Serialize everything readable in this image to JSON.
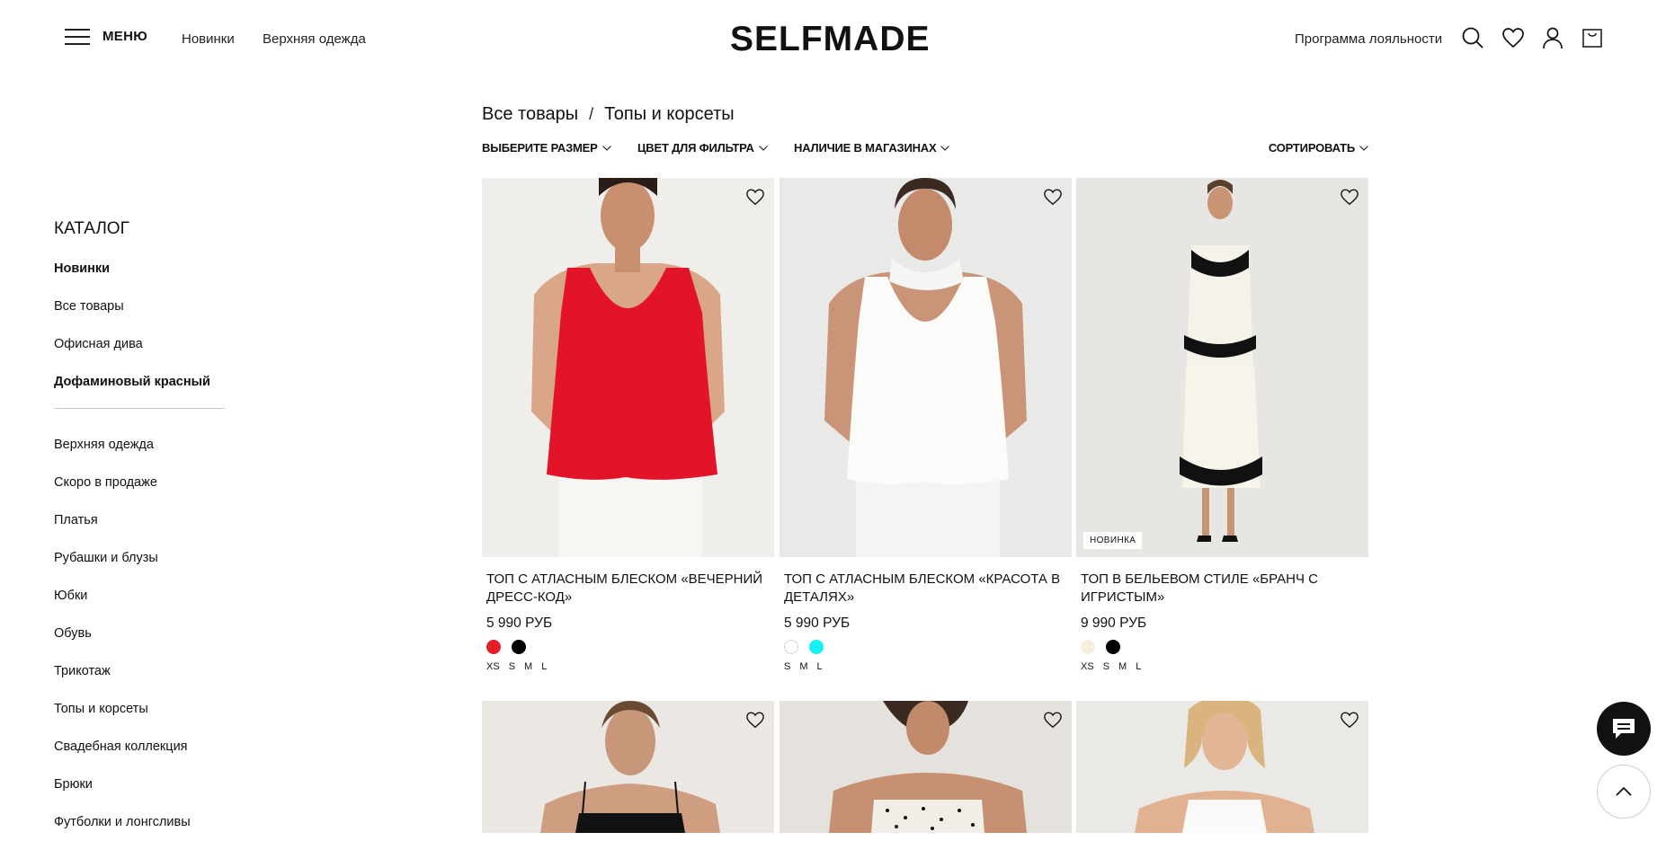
{
  "header": {
    "menu_label": "МЕНЮ",
    "nav": [
      "Новинки",
      "Верхняя одежда"
    ],
    "logo": "SELFMADE",
    "loyalty": "Программа лояльности",
    "icons": [
      "search-icon",
      "heart-icon",
      "user-icon",
      "cart-icon"
    ]
  },
  "sidebar": {
    "title": "КАТАЛОГ",
    "top_items": [
      {
        "label": "Новинки",
        "bold": true
      },
      {
        "label": "Все товары",
        "bold": false
      },
      {
        "label": "Офисная дива",
        "bold": false
      },
      {
        "label": "Дофаминовый красный",
        "bold": true
      }
    ],
    "items": [
      "Верхняя одежда",
      "Скоро в продаже",
      "Платья",
      "Рубашки и блузы",
      "Юбки",
      "Обувь",
      "Трикотаж",
      "Топы и корсеты",
      "Свадебная коллекция",
      "Брюки",
      "Футболки и лонгсливы"
    ]
  },
  "breadcrumb": {
    "root": "Все товары",
    "separator": "/",
    "current": "Топы и корсеты"
  },
  "filters": {
    "size": "ВЫБЕРИТЕ РАЗМЕР",
    "color": "ЦВЕТ ДЛЯ ФИЛЬТРА",
    "availability": "НАЛИЧИЕ В МАГАЗИНАХ",
    "sort": "СОРТИРОВАТЬ"
  },
  "products": [
    {
      "title": "ТОП С АТЛАСНЫМ БЛЕСКОМ «ВЕЧЕРНИЙ ДРЕСС-КОД»",
      "price": "5 990 РУБ",
      "badge": "",
      "swatches": [
        "#e21e26",
        "#000000"
      ],
      "sizes": [
        "XS",
        "S",
        "M",
        "L"
      ]
    },
    {
      "title": "ТОП С АТЛАСНЫМ БЛЕСКОМ «КРАСОТА В ДЕТАЛЯХ»",
      "price": "5 990 РУБ",
      "badge": "",
      "swatches": [
        "#ffffff",
        "#16f0f0"
      ],
      "sizes": [
        "S",
        "M",
        "L"
      ]
    },
    {
      "title": "ТОП В БЕЛЬЕВОМ СТИЛЕ «БРАНЧ С ИГРИСТЫМ»",
      "price": "9 990 РУБ",
      "badge": "НОВИНКА",
      "swatches": [
        "#f6eedd",
        "#000000"
      ],
      "sizes": [
        "XS",
        "S",
        "M",
        "L"
      ]
    }
  ],
  "second_row_count": 3,
  "colors": {
    "text": "#111111",
    "chat_button": "#111111"
  },
  "floating": {
    "chat_icon": "chat-icon",
    "up_icon": "arrow-up-icon"
  }
}
